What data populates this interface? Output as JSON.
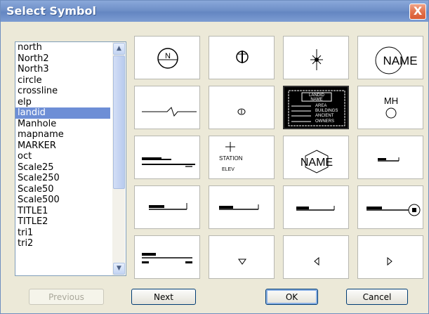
{
  "window": {
    "title": "Select Symbol",
    "close_label": "X"
  },
  "list": {
    "items": [
      "north",
      "North2",
      "North3",
      "circle",
      "crossline",
      "elp",
      "landid",
      "Manhole",
      "mapname",
      "MARKER",
      "oct",
      "Scale25",
      "Scale250",
      "Scale50",
      "Scale500",
      "TITLE1",
      "TITLE2",
      "tri1",
      "tri2"
    ],
    "selected": "landid"
  },
  "symbols": {
    "name_label": "NAME",
    "manhole_label": "MH",
    "station_label": "STATION",
    "elev_label": "ELEV",
    "north_letter": "N",
    "landid_header": "LANDID",
    "landid_name": "NAME",
    "landid_area": "AREA",
    "landid_buildings": "BUILDINGS",
    "landid_ancient": "ANCIENT",
    "landid_owners": "OWNERS"
  },
  "buttons": {
    "previous": "Previous",
    "next": "Next",
    "ok": "OK",
    "cancel": "Cancel"
  }
}
